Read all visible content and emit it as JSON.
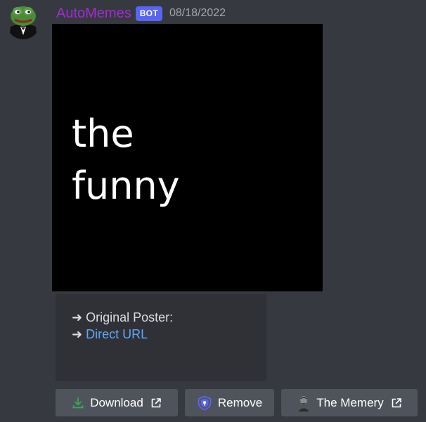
{
  "message": {
    "author": {
      "username": "AutoMemes",
      "bot_tag": "BOT",
      "username_color": "#a52ad8"
    },
    "timestamp": "08/18/2022",
    "image": {
      "lines": [
        "the",
        "funny"
      ],
      "background": "#000000"
    },
    "embed": {
      "arrow": "➜",
      "original_poster_label": "Original Poster:",
      "direct_url_label": "Direct URL"
    },
    "buttons": [
      {
        "label": "Download",
        "icon": "download-icon",
        "external": true
      },
      {
        "label": "Remove",
        "icon": "shield-icon",
        "external": false
      },
      {
        "label": "The Memery",
        "icon": "server-avatar-icon",
        "external": true
      }
    ]
  },
  "colors": {
    "background": "#36393f",
    "embed_background": "#2f3136",
    "button_background": "#4f545c",
    "bot_tag": "#5865f2",
    "link": "#5ea8ff"
  }
}
